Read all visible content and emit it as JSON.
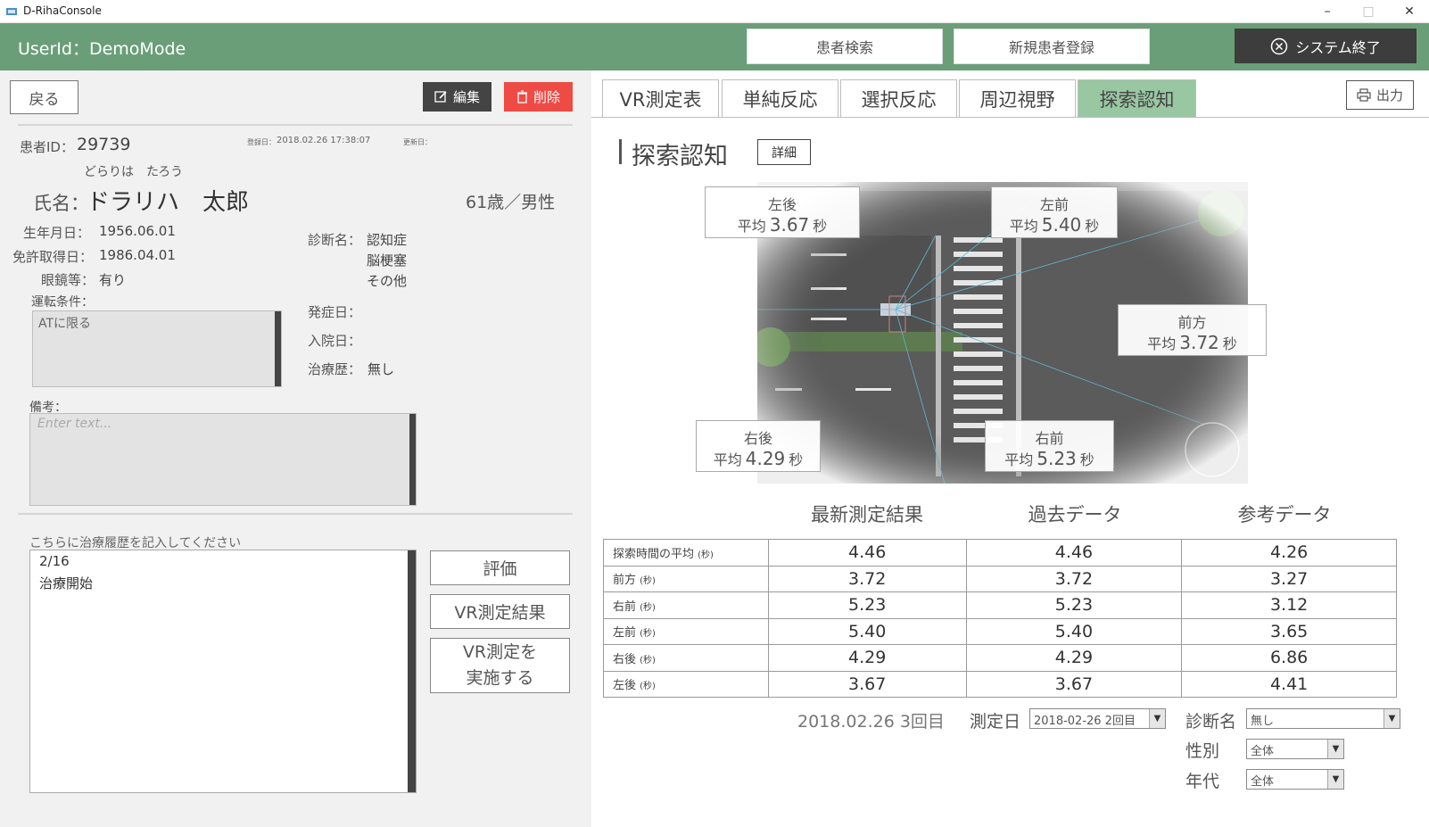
{
  "window": {
    "title": "D-RihaConsole"
  },
  "header": {
    "user_label": "UserId：DemoMode",
    "search_label": "患者検索",
    "register_label": "新規患者登録",
    "exit_label": "システム終了"
  },
  "patient": {
    "back_label": "戻る",
    "edit_label": "編集",
    "delete_label": "削除",
    "id_label": "患者ID：",
    "id_value": "29739",
    "registered_label": "登録日：",
    "registered_value": "2018.02.26 17:38:07",
    "updated_label": "更新日：",
    "kana": "どらりは　たろう",
    "name_label": "氏名：",
    "name_value": "ドラリハ　太郎",
    "age_gender": "61歳／男性",
    "birth_label": "生年月日：",
    "birth_value": "1956.06.01",
    "license_label": "免許取得日：",
    "license_value": "1986.04.01",
    "glasses_label": "眼鏡等：",
    "glasses_value": "有り",
    "diagnosis_label": "診断名：",
    "diagnoses": [
      "認知症",
      "脳梗塞",
      "その他"
    ],
    "driving_cond_label": "運転条件：",
    "driving_cond_value": "ATに限る",
    "onset_label": "発症日：",
    "admission_label": "入院日：",
    "treatment_label": "治療歴：",
    "treatment_value": "無し",
    "notes_label": "備考：",
    "notes_placeholder": "Enter text...",
    "history_label": "こちらに治療履歴を記入してください",
    "history_lines": [
      "2/16",
      "治療開始"
    ],
    "eval_button": "評価",
    "vr_result_button": "VR測定結果",
    "vr_run_line1": "VR測定を",
    "vr_run_line2": "実施する"
  },
  "tabs": [
    "VR測定表",
    "単純反応",
    "選択反応",
    "周辺視野",
    "探索認知"
  ],
  "active_tab": 4,
  "output_label": "出力",
  "section": {
    "title": "探索認知",
    "detail_label": "詳細"
  },
  "directions": {
    "avg_label": "平均",
    "unit": "秒",
    "left_back": {
      "name": "左後",
      "value": "3.67"
    },
    "left_front": {
      "name": "左前",
      "value": "5.40"
    },
    "front": {
      "name": "前方",
      "value": "3.72"
    },
    "right_back": {
      "name": "右後",
      "value": "4.29"
    },
    "right_front": {
      "name": "右前",
      "value": "5.23"
    }
  },
  "table": {
    "headers": [
      "最新測定結果",
      "過去データ",
      "参考データ"
    ],
    "unit": "(秒)",
    "rows": [
      {
        "label": "探索時間の平均",
        "latest": "4.46",
        "past": "4.46",
        "ref": "4.26"
      },
      {
        "label": "前方",
        "latest": "3.72",
        "past": "3.72",
        "ref": "3.27"
      },
      {
        "label": "右前",
        "latest": "5.23",
        "past": "5.23",
        "ref": "3.12"
      },
      {
        "label": "左前",
        "latest": "5.40",
        "past": "5.40",
        "ref": "3.65"
      },
      {
        "label": "右後",
        "latest": "4.29",
        "past": "4.29",
        "ref": "6.86"
      },
      {
        "label": "左後",
        "latest": "3.67",
        "past": "3.67",
        "ref": "4.41"
      }
    ]
  },
  "filters": {
    "latest_date": "2018.02.26 3回目",
    "measure_date_label": "測定日",
    "measure_date_value": "2018-02-26 2回目",
    "diagnosis_label": "診断名",
    "diagnosis_value": "無し",
    "gender_label": "性別",
    "gender_value": "全体",
    "age_label": "年代",
    "age_value": "全体"
  }
}
